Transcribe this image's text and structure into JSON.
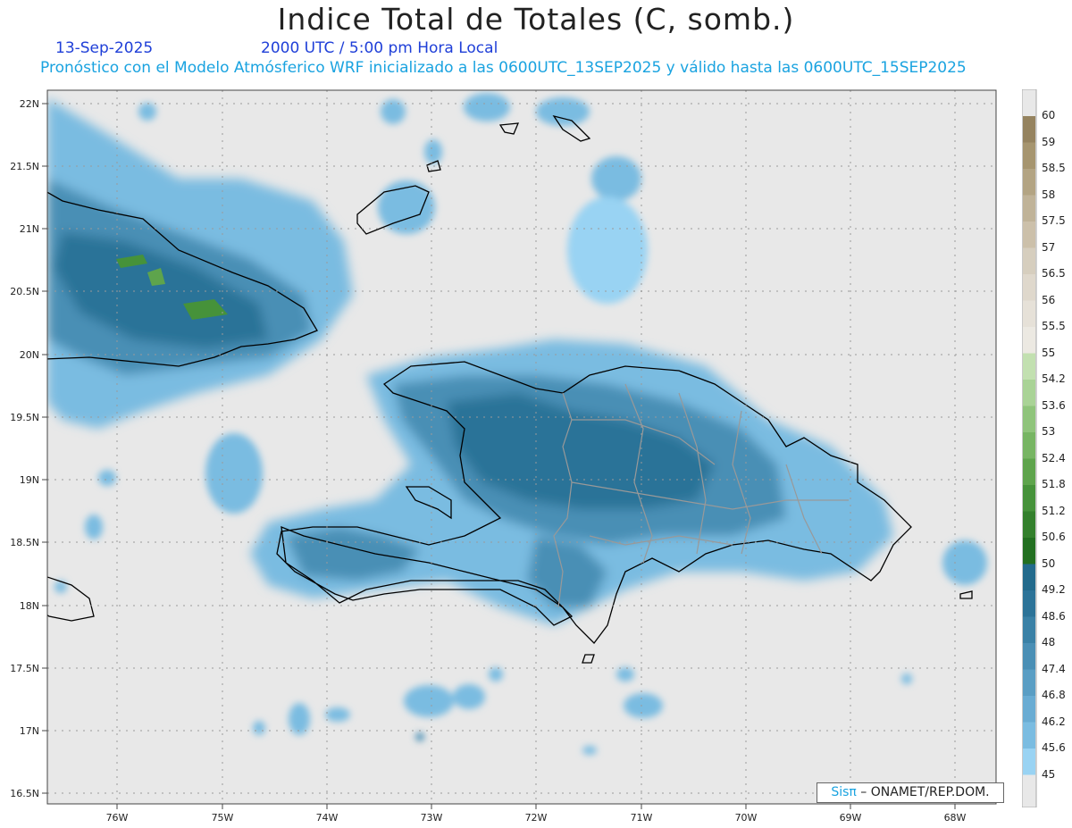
{
  "title": "Indice Total de Totales (C, somb.)",
  "subtitle": {
    "date": "13-Sep-2025",
    "time": "2000 UTC / 5:00 pm Hora Local",
    "forecast": "Pronóstico con el Modelo Atmósferico WRF inicializado a las 0600UTC_13SEP2025 y válido hasta las  0600UTC_15SEP2025"
  },
  "credit": {
    "sis": "Sisπ",
    "rest": " – ONAMET/REP.DOM."
  },
  "axes": {
    "lat_labels": [
      "22N",
      "21.5N",
      "21N",
      "20.5N",
      "20N",
      "19.5N",
      "19N",
      "18.5N",
      "18N",
      "17.5N",
      "17N",
      "16.5N"
    ],
    "lon_labels": [
      "76W",
      "75W",
      "74W",
      "73W",
      "72W",
      "71W",
      "70W",
      "69W",
      "68W"
    ]
  },
  "colorbar": {
    "labels": [
      "60",
      "59",
      "58.5",
      "58",
      "57.5",
      "57",
      "56.5",
      "56",
      "55.5",
      "55",
      "54.2",
      "53.6",
      "53",
      "52.4",
      "51.8",
      "51.2",
      "50.6",
      "50",
      "49.2",
      "48.6",
      "48",
      "47.4",
      "46.8",
      "46.2",
      "45.6",
      "45"
    ],
    "colors": [
      "#e8e8e8",
      "#95835f",
      "#a6956f",
      "#b3a483",
      "#c0b398",
      "#ccc0aa",
      "#d6cebe",
      "#dfd8cc",
      "#e6e1d8",
      "#ece9e2",
      "#c2e0b0",
      "#a9d396",
      "#8fc47b",
      "#77b563",
      "#5ea44c",
      "#46923a",
      "#33802c",
      "#226f20",
      "#226a8c",
      "#2c7398",
      "#3a81a6",
      "#4a8fb5",
      "#5a9ec4",
      "#69acd3",
      "#7abce1",
      "#99d3f3"
    ]
  },
  "basemap": {
    "land_outline_color": "#000000",
    "border_color": "#999999",
    "background": "#e8e8e8"
  }
}
